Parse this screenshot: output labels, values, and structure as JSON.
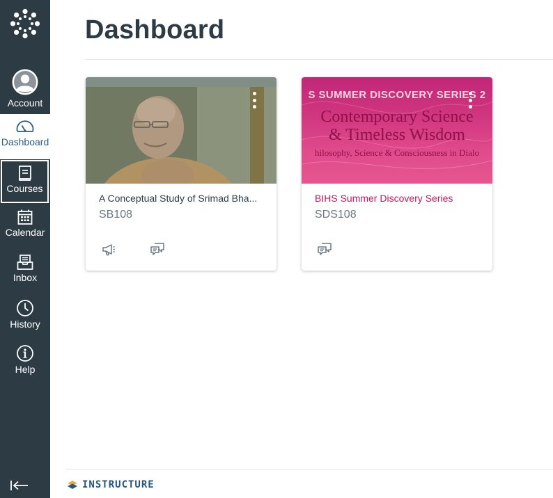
{
  "sidebar": {
    "account_label": "Account",
    "dashboard_label": "Dashboard",
    "courses_label": "Courses",
    "calendar_label": "Calendar",
    "inbox_label": "Inbox",
    "history_label": "History",
    "help_label": "Help",
    "active_item": "Dashboard",
    "colors": {
      "background": "#2d3b45",
      "active_text": "#2d5b84"
    }
  },
  "page": {
    "title": "Dashboard"
  },
  "courses": [
    {
      "title": "A Conceptual Study of Srimad Bha...",
      "code": "SB108",
      "icons": [
        "announcements-icon",
        "discussions-icon"
      ]
    },
    {
      "title": "BIHS Summer Discovery Series",
      "code": "SDS108",
      "title_color": "#c2185b",
      "banner": {
        "top_text": "S SUMMER DISCOVERY SERIES 2",
        "heading_line1": "Contemporary Science",
        "heading_line2": "& Timeless Wisdom",
        "subtitle": "hilosophy, Science & Consciousness in Dialo"
      },
      "icons": [
        "discussions-icon"
      ]
    }
  ],
  "footer": {
    "brand": "INSTRUCTURE"
  }
}
